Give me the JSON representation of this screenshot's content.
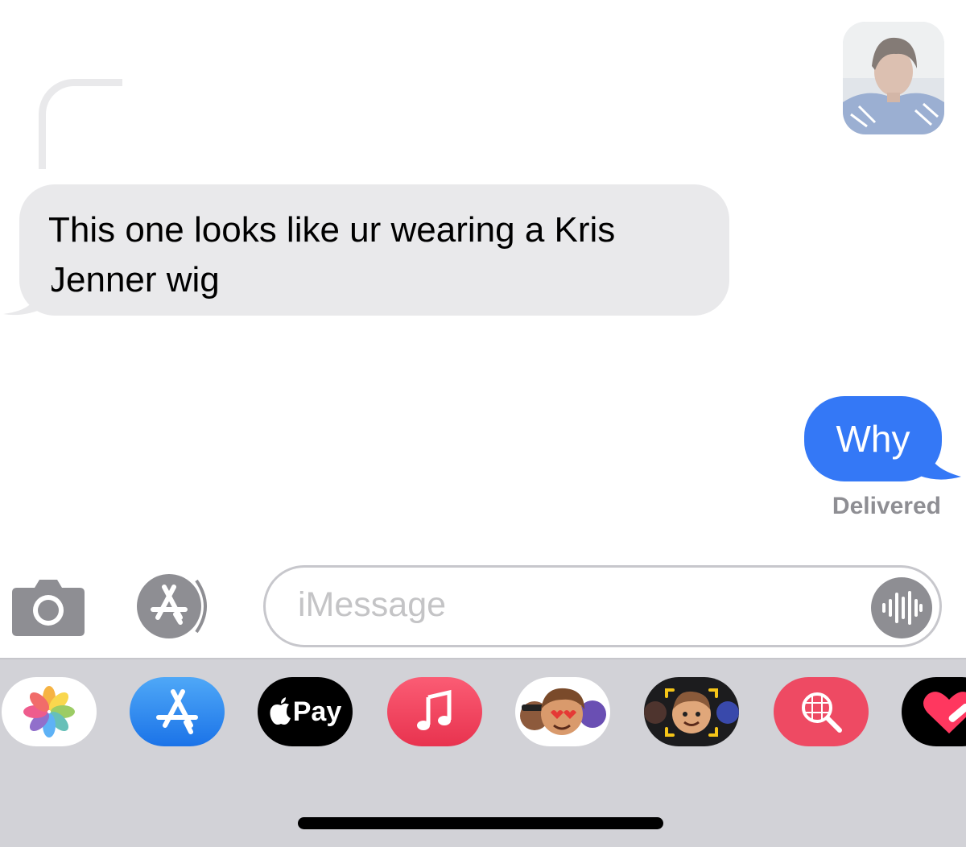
{
  "conversation": {
    "incoming_message": "This one looks like ur wearing a Kris Jenner wig",
    "outgoing_message": "Why",
    "delivery_status": "Delivered"
  },
  "compose": {
    "placeholder": "iMessage"
  },
  "app_drawer": {
    "apps": [
      {
        "name": "photos-app",
        "icon": "photos-flower-icon"
      },
      {
        "name": "app-store",
        "icon": "app-store-icon"
      },
      {
        "name": "apple-pay",
        "label": "Pay",
        "icon": "apple-logo-icon"
      },
      {
        "name": "music",
        "icon": "music-note-icon"
      },
      {
        "name": "memoji-stickers",
        "icon": "memoji-icon"
      },
      {
        "name": "memoji-camera",
        "icon": "memoji-camera-icon"
      },
      {
        "name": "image-search",
        "icon": "globe-search-icon"
      },
      {
        "name": "digital-touch",
        "icon": "heart-icon"
      }
    ]
  },
  "colors": {
    "incoming_bubble": "#e9e9eb",
    "outgoing_bubble": "#3478f6",
    "delivered_text": "#8e8e93",
    "drawer_background": "#d2d2d7"
  }
}
